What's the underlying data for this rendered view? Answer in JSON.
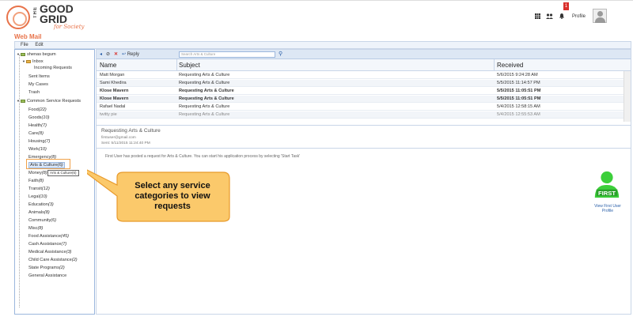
{
  "header": {
    "logo_the": "THE",
    "logo_line1": "GOOD",
    "logo_line2": "GRID",
    "logo_tagline": "for Society",
    "badge_count": "1",
    "profile_label": "Profile",
    "icons": [
      "grid-icon",
      "people-icon",
      "bell-icon"
    ]
  },
  "webmail": {
    "title": "Web Mail",
    "menu": [
      "File",
      "Edit"
    ]
  },
  "tree": {
    "user": "shenas begum",
    "inbox": "Inbox",
    "incoming": "Incoming Requests",
    "sent": "Sent Items",
    "cases": "My Cases",
    "trash": "Trash",
    "common": "Common Service Requests",
    "categories": [
      {
        "name": "Food",
        "count": "(22)"
      },
      {
        "name": "Goods",
        "count": "(10)"
      },
      {
        "name": "Health",
        "count": "(7)"
      },
      {
        "name": "Care",
        "count": "(8)"
      },
      {
        "name": "Housing",
        "count": "(7)"
      },
      {
        "name": "Work",
        "count": "(10)"
      },
      {
        "name": "Emergency",
        "count": "(8)"
      },
      {
        "name": "Arts & Culture",
        "count": "(6)"
      },
      {
        "name": "Money",
        "count": "(8)"
      },
      {
        "name": "Faith",
        "count": "(8)"
      },
      {
        "name": "Transit",
        "count": "(12)"
      },
      {
        "name": "Legal",
        "count": "(10)"
      },
      {
        "name": "Education",
        "count": "(3)"
      },
      {
        "name": "Animals",
        "count": "(8)"
      },
      {
        "name": "Community",
        "count": "(6)"
      },
      {
        "name": "Misc",
        "count": "(8)"
      },
      {
        "name": "Food Assistance",
        "count": "(45)"
      },
      {
        "name": "Cash Assistance",
        "count": "(7)"
      },
      {
        "name": "Medical Assistance",
        "count": "(3)"
      },
      {
        "name": "Child Care Assistance",
        "count": "(2)"
      },
      {
        "name": "State Programs",
        "count": "(2)"
      },
      {
        "name": "General Assistance",
        "count": ""
      }
    ],
    "tooltip": "Arts & Culture(6)"
  },
  "toolbar": {
    "reply": "Reply",
    "search_placeholder": "Search Arts & Culture"
  },
  "grid": {
    "columns": [
      "Name",
      "Subject",
      "Received"
    ],
    "rows": [
      {
        "name": "Matt Morgan",
        "subject": "Requesting Arts & Culture",
        "received": "5/6/2015 9:24:28 AM"
      },
      {
        "name": "Sami Khedira",
        "subject": "Requesting Arts & Culture",
        "received": "5/5/2015 11:14:57 PM"
      },
      {
        "name": "Klose Mavern",
        "subject": "Requesting Arts & Culture",
        "received": "5/5/2015 11:05:51 PM"
      },
      {
        "name": "Klose Mavern",
        "subject": "Requesting Arts & Culture",
        "received": "5/5/2015 11:05:51 PM"
      },
      {
        "name": "Rafael Nadal",
        "subject": "Requesting Arts & Culture",
        "received": "5/4/2015 12:58:15 AM"
      },
      {
        "name": "twitty pie",
        "subject": "Requesting Arts & Culture",
        "received": "5/4/2015 12:55:53 AM"
      }
    ]
  },
  "preview": {
    "subject": "Requesting Arts & Culture",
    "from": "firstuser@gmail.com",
    "sent": "Sent: 5/11/2015 11:24:40 PM",
    "body": "First User has posted a request for Arts & Culture. You can start his application process by selecting 'Start Task'"
  },
  "callout": {
    "line1": "Select any service",
    "line2": "categories to view",
    "line3": "requests"
  },
  "first_user": {
    "badge": "FIRST",
    "label": "View First User Profile"
  },
  "colors": {
    "accent": "#e8734a",
    "callout_fill": "#fbc96b",
    "first_green": "#3ccf3a"
  }
}
